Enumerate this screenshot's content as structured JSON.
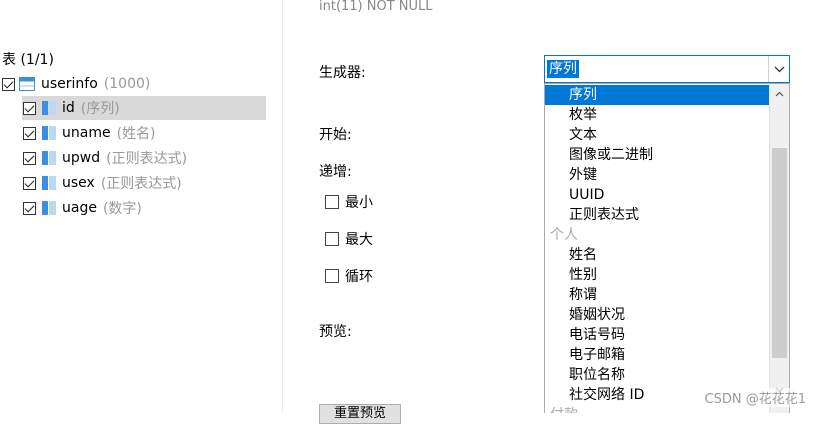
{
  "top_hint": "int(11) NOT NULL",
  "tree": {
    "title": "表 (1/1)",
    "table": {
      "name": "userinfo",
      "hint": "(1000)"
    },
    "columns": [
      {
        "name": "id",
        "hint": "(序列)",
        "selected": true
      },
      {
        "name": "uname",
        "hint": "(姓名)"
      },
      {
        "name": "upwd",
        "hint": "(正则表达式)"
      },
      {
        "name": "usex",
        "hint": "(正则表达式)"
      },
      {
        "name": "uage",
        "hint": "(数字)"
      }
    ]
  },
  "props": {
    "generator_label": "生成器:",
    "start_label": "开始:",
    "increment_label": "递增:",
    "min_label": "最小",
    "max_label": "最大",
    "cycle_label": "循环",
    "preview_label": "预览:",
    "preview_button_label": "重置预览"
  },
  "combo": {
    "value": "序列",
    "items": [
      "序列",
      "枚举",
      "文本",
      "图像或二进制",
      "外键",
      "UUID",
      "正则表达式"
    ],
    "group_personal": "个人",
    "personal_items": [
      "姓名",
      "性别",
      "称谓",
      "婚姻状况",
      "电话号码",
      "电子邮箱",
      "职位名称",
      "社交网络 ID"
    ],
    "group_next": "付款"
  },
  "watermark": "CSDN @花花花1",
  "colors": {
    "accent": "#0078d7",
    "selection_gray": "#d9d9d9"
  }
}
